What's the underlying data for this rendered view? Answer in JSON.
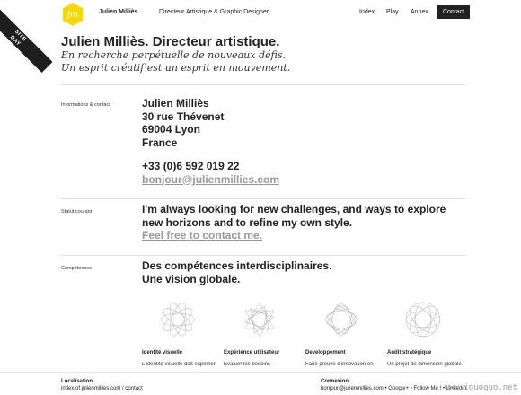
{
  "ribbon": {
    "line1": "SITE",
    "line2": "DAY"
  },
  "header": {
    "logo_text": "jm",
    "site_name": "Julien Milliès",
    "role": "Directeur Artistique & Graphic Designer",
    "nav": {
      "index": "Index",
      "play": "Play",
      "annex": "Annex",
      "contact": "Contact"
    }
  },
  "hero": {
    "title": "Julien Milliès. Directeur artistique.",
    "line1": "En recherche perpétuelle de nouveaux défis.",
    "line2": "Un esprit créatif est un esprit en mouvement."
  },
  "info": {
    "label": "Informations & contact",
    "name": "Julien Milliès",
    "street": "30 rue Thévenet",
    "city": "69004 Lyon",
    "country": "France",
    "phone": "+33 (0)6 592 019 22",
    "email": "bonjour@julienmillies.com"
  },
  "status": {
    "label": "Statut courant",
    "text": "I'm always looking for new challenges, and ways to explore new horizons and to refine my own style.",
    "link": "Feel free to contact me."
  },
  "skills": {
    "label": "Compétences",
    "title1": "Des compétences interdisciplinaires.",
    "title2": "Une vision globale.",
    "items": [
      {
        "title": "Identité visuelle",
        "desc": "L'identité visuelle doit exprimer"
      },
      {
        "title": "Expérience utilisateur",
        "desc": "Evaluer les besoins"
      },
      {
        "title": "Developpement",
        "desc": "Faire preuve d'innovation en"
      },
      {
        "title": "Audit stratégique",
        "desc": "Un projet de dimension globale"
      }
    ]
  },
  "footer": {
    "loc_title": "Localisation",
    "loc_prefix": "index of ",
    "loc_link": "julienmillies.com",
    "loc_sep": " / ",
    "loc_page": "contact",
    "conn_title": "Connexion",
    "conn_text": "bonjour@julienmillies.com • Google+ • Follow Me ! • Linkedin"
  },
  "watermark": "www.iguoguo.net",
  "colors": {
    "accent": "#f5d800",
    "dark": "#222222",
    "link_grey": "#999999"
  }
}
